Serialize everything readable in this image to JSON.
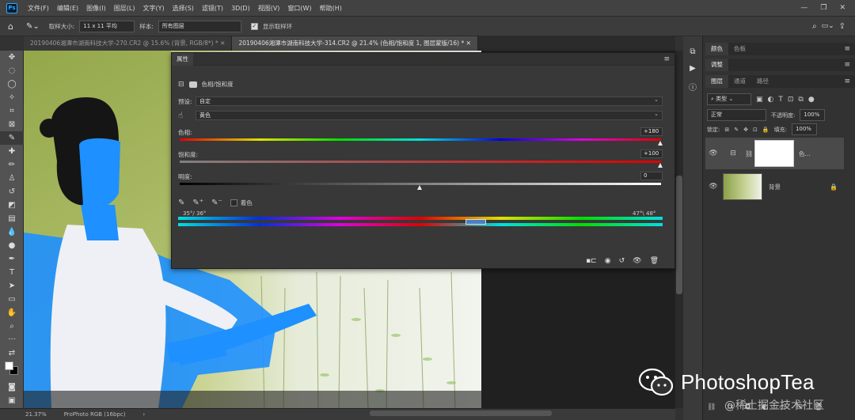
{
  "app": {
    "logo": "Ps"
  },
  "menu": [
    "文件(F)",
    "编辑(E)",
    "图像(I)",
    "图层(L)",
    "文字(Y)",
    "选择(S)",
    "滤镜(T)",
    "3D(D)",
    "视图(V)",
    "窗口(W)",
    "帮助(H)"
  ],
  "options": {
    "sample_size_label": "取样大小:",
    "sample_size_value": "11 x 11 平均",
    "sample_label": "样本:",
    "sample_value": "所有图层",
    "show_ring_label": "显示取样环"
  },
  "tabs": [
    {
      "label": "20190406湘潭市湖南科技大学-270.CR2 @ 15.6% (背景, RGB/8*) *",
      "active": false
    },
    {
      "label": "20190406湘潭市湖南科技大学-314.CR2 @ 21.4% (色相/饱和度 1, 图层蒙版/16) *",
      "active": true
    }
  ],
  "properties": {
    "tab": "属性",
    "adjustment_name": "色相/饱和度",
    "preset_label": "预设:",
    "preset_value": "自定",
    "channel_value": "黄色",
    "hue_label": "色相:",
    "hue_value": "+180",
    "hue_level": 1.0,
    "saturation_label": "饱和度:",
    "saturation_value": "+100",
    "saturation_level": 1.0,
    "lightness_label": "明度:",
    "lightness_value": "0",
    "lightness_level": 0.5,
    "colorize_label": "着色",
    "range_left": "35°/ 36°",
    "range_right": "47°\\ 48°"
  },
  "status": {
    "zoom": "21.37%",
    "profile": "ProPhoto RGB (16bpc)"
  },
  "right_panels": {
    "top_tabs": [
      "颜色",
      "色板"
    ],
    "adjust_tab": "调整",
    "layer_tabs": [
      "图层",
      "通道",
      "路径"
    ],
    "kind_filter": "类型",
    "blend_mode": "正常",
    "opacity_label": "不透明度:",
    "opacity_value": "100%",
    "lock_label": "锁定:",
    "fill_label": "填充:",
    "fill_value": "100%",
    "layers": [
      {
        "name": "色...",
        "type": "adjustment"
      },
      {
        "name": "背景",
        "type": "image"
      }
    ]
  },
  "watermark": {
    "brand": "PhotoshopTea",
    "sub": "@稀土掘金技术社区"
  },
  "colors": {
    "accent": "#31a8ff",
    "mask_blue": "#1e90ff"
  }
}
